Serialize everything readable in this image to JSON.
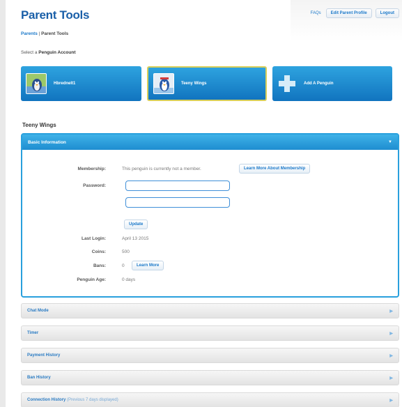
{
  "header": {
    "title": "Parent Tools",
    "breadcrumb": {
      "link": "Parents",
      "separator": " | ",
      "current": "Parent Tools"
    },
    "faq": "FAQs",
    "edit_profile": "Edit Parent Profile",
    "logout": "Logout"
  },
  "account_select": {
    "label_prefix": "Select a ",
    "label_bold": "Penguin Account",
    "accounts": [
      {
        "name": "Hbrednelt1"
      },
      {
        "name": "Teeny Wings",
        "selected": true
      },
      {
        "name": "Add A Penguin",
        "icon": "plus-icon"
      }
    ]
  },
  "penguin": {
    "name": "Teeny Wings",
    "basic_info": {
      "heading": "Basic Information",
      "membership_label": "Membership:",
      "membership_value": "This penguin is currently not a member.",
      "membership_button": "Learn More About Membership",
      "password_label": "Password:",
      "update_button": "Update",
      "last_login_label": "Last Login:",
      "last_login_value": "April 13 2015",
      "coins_label": "Coins:",
      "coins_value": "500",
      "bans_label": "Bans:",
      "bans_value": "0",
      "bans_button": "Learn More",
      "age_label": "Penguin Age:",
      "age_value": "0 days"
    }
  },
  "sections": [
    {
      "label": "Chat Mode"
    },
    {
      "label": "Timer"
    },
    {
      "label": "Payment History"
    },
    {
      "label": "Ban History"
    },
    {
      "label": "Connection History",
      "sub": "(Previous 7 days displayed)"
    }
  ],
  "colors": {
    "accent": "#1e8dd0",
    "title": "#1a5fa8",
    "selected_border": "#d9cf5a"
  }
}
